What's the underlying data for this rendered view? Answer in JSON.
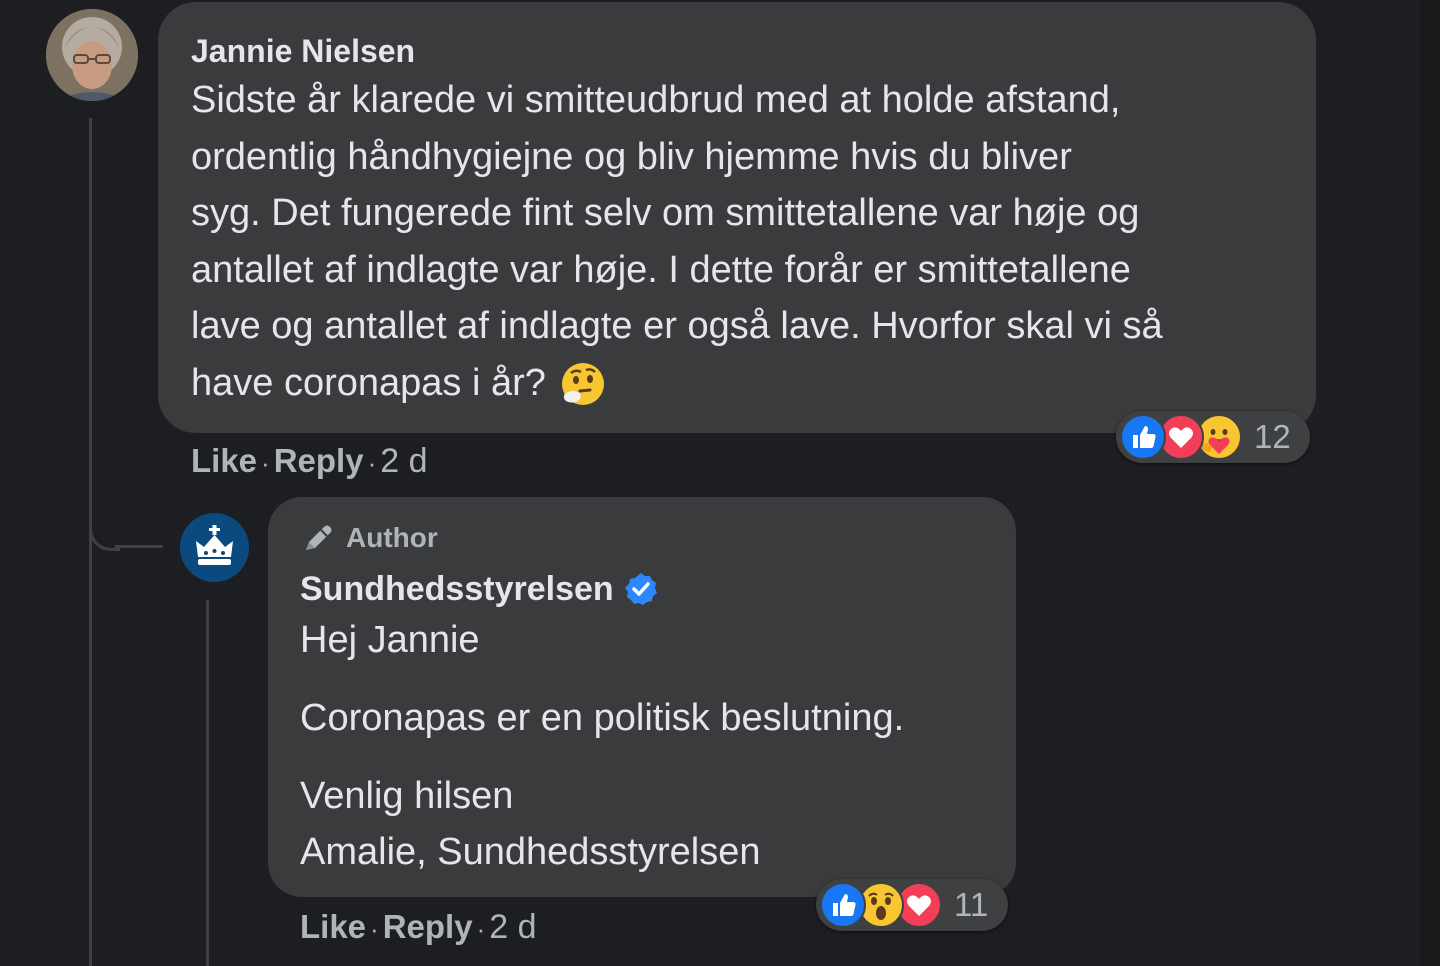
{
  "comment": {
    "author": "Jannie Nielsen",
    "lines": [
      "Sidste år klarede vi smitteudbrud med at holde afstand,",
      "ordentlig håndhygiejne og bliv hjemme hvis du bliver",
      "syg. Det fungerede fint selv om smittetallene var høje og",
      "antallet af indlagte var høje. I dette forår er smittetallene",
      "lave og antallet af indlagte er også lave. Hvorfor skal vi så",
      "have coronapas i år?"
    ],
    "emoji": "thinking-face-icon",
    "like_label": "Like",
    "reply_label": "Reply",
    "separator": "·",
    "timestamp": "2 d",
    "reactions": {
      "icons": [
        "like-reaction-icon",
        "love-reaction-icon",
        "care-reaction-icon"
      ],
      "count": "12"
    }
  },
  "reply": {
    "badge": "Author",
    "author": "Sundhedsstyrelsen",
    "verified": true,
    "paragraphs": [
      "Hej Jannie",
      "Coronapas er en politisk beslutning.",
      "Venlig hilsen",
      "Amalie, Sundhedsstyrelsen"
    ],
    "like_label": "Like",
    "reply_label": "Reply",
    "separator": "·",
    "timestamp": "2 d",
    "reactions": {
      "icons": [
        "like-reaction-icon",
        "wow-reaction-icon",
        "love-reaction-icon"
      ],
      "count": "11"
    }
  },
  "colors": {
    "background": "#1c1e21",
    "bubble": "#3a3b3c",
    "text": "#e4e6eb",
    "secondary_text": "#b0b3b8",
    "like_blue": "#1877f2",
    "love_red": "#f33e58",
    "verified_blue": "#2d88ff",
    "avatar_blue": "#0b4a7e"
  }
}
